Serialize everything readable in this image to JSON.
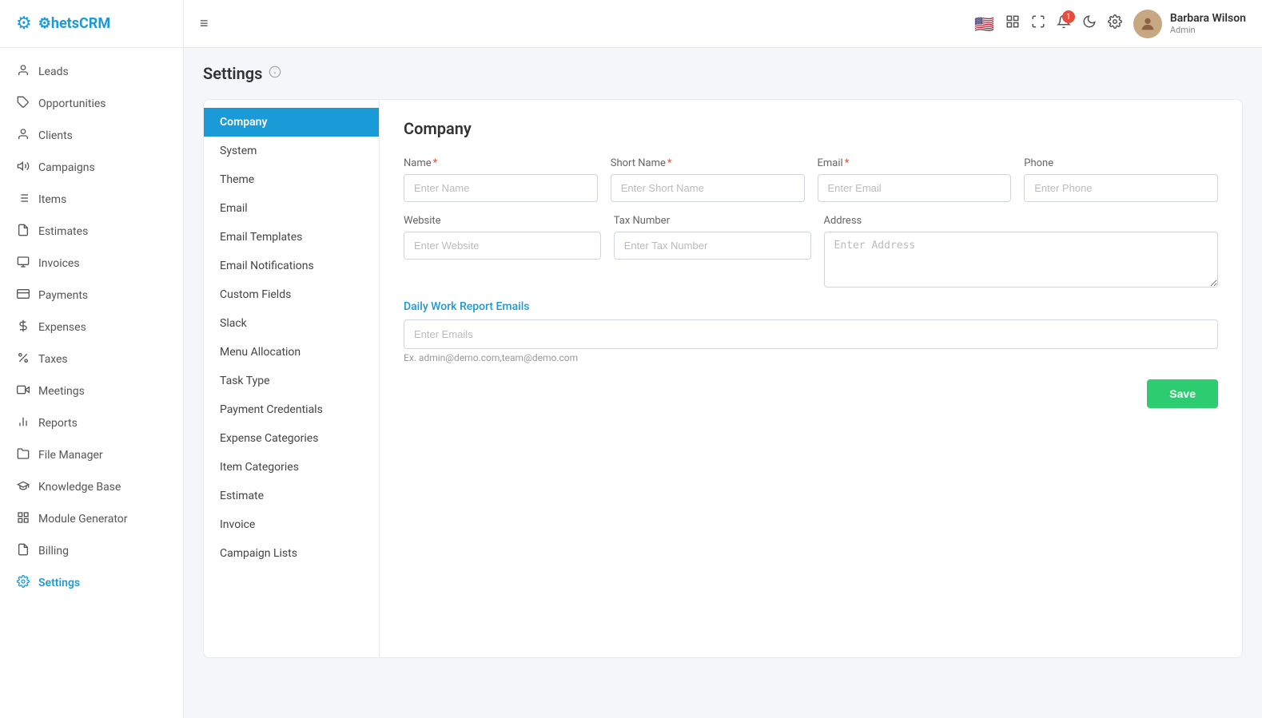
{
  "app": {
    "name": "ChetsCRM",
    "logo_icon": "⚙"
  },
  "header": {
    "menu_icon": "≡",
    "notification_count": "1",
    "user": {
      "name": "Barbara Wilson",
      "role": "Admin"
    }
  },
  "sidebar": {
    "items": [
      {
        "id": "leads",
        "label": "Leads",
        "icon": "👤"
      },
      {
        "id": "opportunities",
        "label": "Opportunities",
        "icon": "🏷"
      },
      {
        "id": "clients",
        "label": "Clients",
        "icon": "👤"
      },
      {
        "id": "campaigns",
        "label": "Campaigns",
        "icon": "✳"
      },
      {
        "id": "items",
        "label": "Items",
        "icon": "☰"
      },
      {
        "id": "estimates",
        "label": "Estimates",
        "icon": "📋"
      },
      {
        "id": "invoices",
        "label": "Invoices",
        "icon": "📄"
      },
      {
        "id": "payments",
        "label": "Payments",
        "icon": "💳"
      },
      {
        "id": "expenses",
        "label": "Expenses",
        "icon": "📊"
      },
      {
        "id": "taxes",
        "label": "Taxes",
        "icon": "✂"
      },
      {
        "id": "meetings",
        "label": "Meetings",
        "icon": "📹"
      },
      {
        "id": "reports",
        "label": "Reports",
        "icon": "📈"
      },
      {
        "id": "file-manager",
        "label": "File Manager",
        "icon": "📁"
      },
      {
        "id": "knowledge-base",
        "label": "Knowledge Base",
        "icon": "🎓"
      },
      {
        "id": "module-generator",
        "label": "Module Generator",
        "icon": "⊞"
      },
      {
        "id": "billing",
        "label": "Billing",
        "icon": "📄"
      },
      {
        "id": "settings",
        "label": "Settings",
        "icon": "⚙",
        "active": true
      }
    ]
  },
  "page": {
    "title": "Settings"
  },
  "settings_nav": {
    "items": [
      {
        "id": "company",
        "label": "Company",
        "active": true
      },
      {
        "id": "system",
        "label": "System"
      },
      {
        "id": "theme",
        "label": "Theme"
      },
      {
        "id": "email",
        "label": "Email"
      },
      {
        "id": "email-templates",
        "label": "Email Templates"
      },
      {
        "id": "email-notifications",
        "label": "Email Notifications"
      },
      {
        "id": "custom-fields",
        "label": "Custom Fields"
      },
      {
        "id": "slack",
        "label": "Slack"
      },
      {
        "id": "menu-allocation",
        "label": "Menu Allocation"
      },
      {
        "id": "task-type",
        "label": "Task Type"
      },
      {
        "id": "payment-credentials",
        "label": "Payment Credentials"
      },
      {
        "id": "expense-categories",
        "label": "Expense Categories"
      },
      {
        "id": "item-categories",
        "label": "Item Categories"
      },
      {
        "id": "estimate",
        "label": "Estimate"
      },
      {
        "id": "invoice",
        "label": "Invoice"
      },
      {
        "id": "campaign-lists",
        "label": "Campaign Lists"
      }
    ]
  },
  "company_form": {
    "section_title": "Company",
    "fields": {
      "name_label": "Name",
      "name_placeholder": "Enter Name",
      "short_name_label": "Short Name",
      "short_name_placeholder": "Enter Short Name",
      "email_label": "Email",
      "email_placeholder": "Enter Email",
      "phone_label": "Phone",
      "phone_placeholder": "Enter Phone",
      "website_label": "Website",
      "website_placeholder": "Enter Website",
      "tax_number_label": "Tax Number",
      "tax_number_placeholder": "Enter Tax Number",
      "address_label": "Address",
      "address_placeholder": "Enter Address"
    },
    "daily_emails": {
      "label": "Daily Work Report Emails",
      "placeholder": "Enter Emails",
      "hint": "Ex. admin@demo.com,team@demo.com"
    },
    "save_button": "Save"
  }
}
